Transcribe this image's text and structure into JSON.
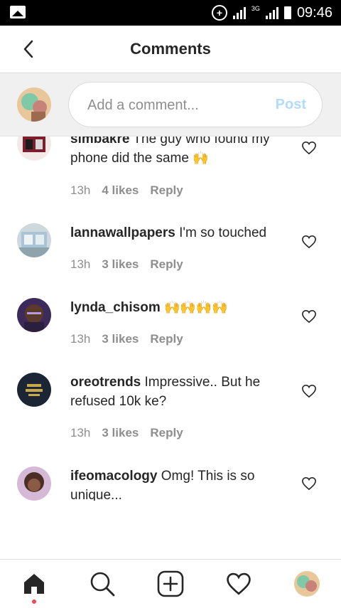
{
  "status_bar": {
    "time": "09:46",
    "network": "3G",
    "icons": [
      "image-icon",
      "data-saver-icon",
      "signal-icon",
      "signal-3g-icon",
      "battery-icon"
    ]
  },
  "header": {
    "title": "Comments",
    "back_icon": "chevron-left-icon"
  },
  "composer": {
    "placeholder": "Add a comment...",
    "post_label": "Post",
    "post_color": "#b3dbff"
  },
  "comments": [
    {
      "user": "simbakre",
      "text": "The guy who found my phone did the same",
      "emoji": "🙌",
      "time": "13h",
      "likes": "4 likes",
      "reply": "Reply"
    },
    {
      "user": "lannawallpapers",
      "text": "I'm so touched",
      "emoji": "",
      "time": "13h",
      "likes": "3 likes",
      "reply": "Reply"
    },
    {
      "user": "lynda_chisom",
      "text": "",
      "emoji": "🙌🙌🙌🙌",
      "time": "13h",
      "likes": "3 likes",
      "reply": "Reply"
    },
    {
      "user": "oreotrends",
      "text": "Impressive.. But he refused 10k ke?",
      "emoji": "",
      "time": "13h",
      "likes": "3 likes",
      "reply": "Reply"
    },
    {
      "user": "ifeomacology",
      "text": "Omg! This is so unique...",
      "emoji": "",
      "time": "",
      "likes": "",
      "reply": ""
    }
  ],
  "bottom_nav": {
    "items": [
      "home-icon",
      "search-icon",
      "add-post-icon",
      "activity-heart-icon",
      "profile-avatar"
    ],
    "active": "home-icon",
    "indicator_color": "#ed4956"
  }
}
